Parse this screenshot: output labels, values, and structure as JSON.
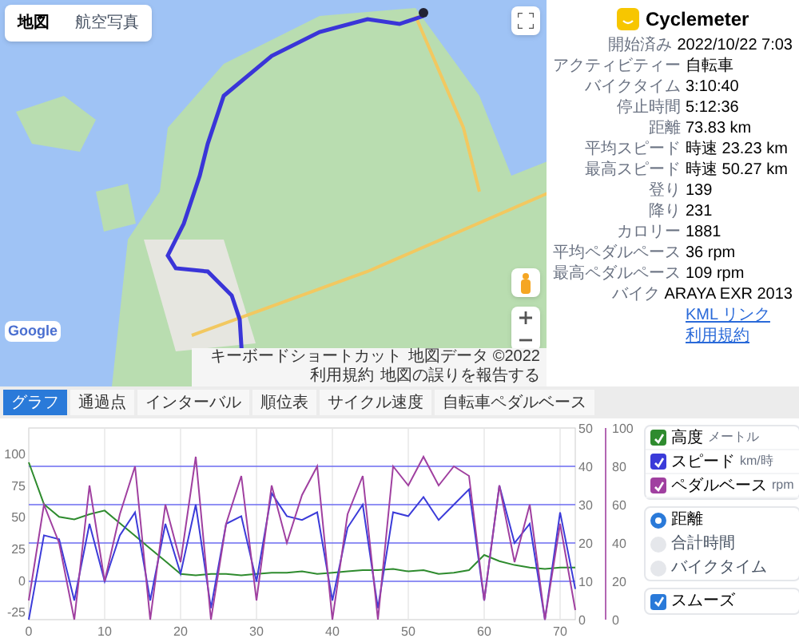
{
  "map": {
    "map_types": [
      {
        "label": "地図",
        "selected": true
      },
      {
        "label": "航空写真",
        "selected": false
      }
    ],
    "logo": "Google",
    "attribution": [
      "キーボードショートカット",
      "地図データ ©2022",
      "利用規約",
      "地図の誤りを報告する"
    ]
  },
  "summary": {
    "app_name": "Cyclemeter",
    "rows": [
      {
        "label": "開始済み",
        "value": "2022/10/22 7:03"
      },
      {
        "label": "アクティビティー",
        "value": "自転車"
      },
      {
        "label": "バイクタイム",
        "value": "3:10:40"
      },
      {
        "label": "停止時間",
        "value": "5:12:36"
      },
      {
        "label": "距離",
        "value": "73.83 km"
      },
      {
        "label": "平均スピード",
        "value": "時速 23.23 km"
      },
      {
        "label": "最高スピード",
        "value": "時速 50.27 km"
      },
      {
        "label": "登り",
        "value": "139"
      },
      {
        "label": "降り",
        "value": "231"
      },
      {
        "label": "カロリー",
        "value": "1881"
      },
      {
        "label": "平均ペダルペース",
        "value": "36 rpm"
      },
      {
        "label": "最高ペダルペース",
        "value": "109 rpm"
      },
      {
        "label": "バイク",
        "value": "ARAYA EXR 2013"
      }
    ],
    "links": [
      "KML リンク",
      "利用規約"
    ]
  },
  "tabs": [
    {
      "label": "グラフ",
      "selected": true
    },
    {
      "label": "通過点",
      "selected": false
    },
    {
      "label": "インターバル",
      "selected": false
    },
    {
      "label": "順位表",
      "selected": false
    },
    {
      "label": "サイクル速度",
      "selected": false
    },
    {
      "label": "自転車ペダルベース",
      "selected": false
    }
  ],
  "chart": {
    "chart_data": {
      "type": "line",
      "grid": true,
      "x": [
        0,
        2,
        4,
        6,
        8,
        10,
        12,
        14,
        16,
        18,
        20,
        22,
        24,
        26,
        28,
        30,
        32,
        34,
        36,
        38,
        40,
        42,
        44,
        46,
        48,
        50,
        52,
        54,
        56,
        58,
        60,
        62,
        64,
        66,
        68,
        70,
        72
      ],
      "xlim": [
        0,
        72
      ],
      "xticks": [
        0,
        10,
        20,
        30,
        40,
        50,
        60,
        70
      ],
      "ylim": [
        -31,
        120
      ],
      "yticks": [
        -25,
        0,
        25,
        50,
        75,
        100
      ],
      "y2lim": [
        0,
        50
      ],
      "y2ticks": [
        0,
        10,
        20,
        30,
        40,
        50
      ],
      "y3lim": [
        0,
        100
      ],
      "y3ticks": [
        0,
        20,
        40,
        60,
        80,
        100
      ],
      "series": [
        {
          "name": "高度",
          "color": "#2e8b2e",
          "axis": "y",
          "values": [
            93,
            60,
            50,
            48,
            52,
            55,
            45,
            35,
            25,
            15,
            5,
            4,
            5,
            5,
            4,
            5,
            6,
            6,
            7,
            5,
            6,
            7,
            8,
            8,
            9,
            7,
            8,
            5,
            6,
            8,
            20,
            15,
            12,
            10,
            9,
            10,
            10
          ]
        },
        {
          "name": "スピード",
          "color": "#3b3bd9",
          "axis": "y2",
          "values": [
            0,
            22,
            21,
            5,
            25,
            10,
            22,
            28,
            5,
            25,
            12,
            30,
            3,
            25,
            27,
            10,
            33,
            27,
            26,
            28,
            5,
            24,
            30,
            3,
            28,
            27,
            32,
            26,
            30,
            34,
            5,
            35,
            20,
            25,
            0,
            28,
            8
          ]
        },
        {
          "name": "ペダルベース",
          "color": "#a040a0",
          "axis": "y3",
          "values": [
            10,
            60,
            40,
            0,
            70,
            20,
            55,
            80,
            0,
            60,
            30,
            85,
            0,
            50,
            75,
            10,
            70,
            40,
            65,
            80,
            0,
            55,
            75,
            0,
            80,
            70,
            85,
            70,
            80,
            75,
            10,
            70,
            30,
            60,
            0,
            50,
            5
          ]
        }
      ]
    }
  },
  "legend": {
    "units": [
      {
        "unit": "メートル",
        "checked": true
      },
      {
        "unit": "km/時",
        "checked": true
      },
      {
        "unit": "rpm",
        "checked": true
      }
    ],
    "x_modes": [
      {
        "label": "距離",
        "selected": true
      },
      {
        "label": "合計時間",
        "selected": false
      },
      {
        "label": "バイクタイム",
        "selected": false
      }
    ],
    "smooth": {
      "label": "スムーズ",
      "checked": true
    }
  }
}
